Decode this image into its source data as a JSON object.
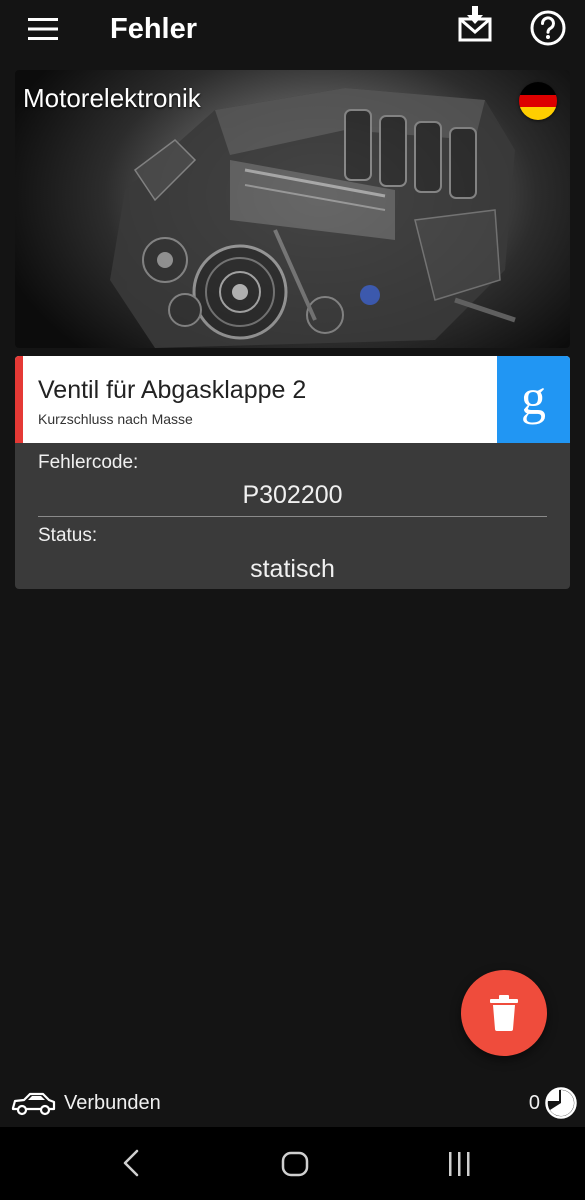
{
  "app_bar": {
    "title": "Fehler",
    "icons": {
      "menu": "menu-icon",
      "export": "download-mail-icon",
      "help": "help-circle-icon"
    }
  },
  "module": {
    "name": "Motorelektronik",
    "language_flag": "germany-flag",
    "flag_colors": [
      "#000000",
      "#dd0000",
      "#ffce00"
    ]
  },
  "error": {
    "title": "Ventil für Abgasklappe 2",
    "subtitle": "Kurzschluss nach Masse",
    "severity_color": "#e53935",
    "search_icon": "google-g-icon",
    "search_color": "#2196f3",
    "code_label": "Fehlercode:",
    "code_value": "P302200",
    "status_label": "Status:",
    "status_value": "statisch"
  },
  "fab": {
    "icon": "trash-icon",
    "color": "#ef4c3c"
  },
  "status_bar": {
    "connection_icon": "car-icon",
    "connection_text": "Verbunden",
    "count": "0",
    "count_icon": "pie-chart-icon"
  },
  "nav_bar": {
    "back": "back-icon",
    "home": "home-icon",
    "recent": "recent-apps-icon"
  }
}
